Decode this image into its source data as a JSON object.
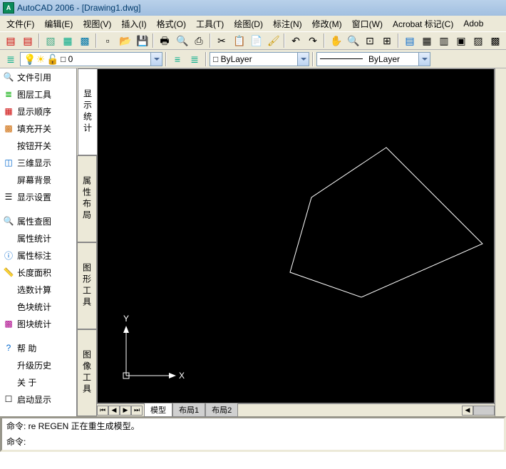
{
  "title": "AutoCAD 2006 - [Drawing1.dwg]",
  "menu": {
    "file": "文件(F)",
    "edit": "编辑(E)",
    "view": "视图(V)",
    "insert": "插入(I)",
    "format": "格式(O)",
    "tools": "工具(T)",
    "draw": "绘图(D)",
    "dim": "标注(N)",
    "modify": "修改(M)",
    "window": "窗口(W)",
    "acrobat": "Acrobat 标记(C)",
    "adobe": "Adob"
  },
  "layer_combo": "□ 0",
  "prop_combo1": "□ ByLayer",
  "prop_combo2": " ByLayer",
  "side": {
    "i1": "文件引用",
    "i2": "图层工具",
    "i3": "显示顺序",
    "i4": "填充开关",
    "i5": "按钮开关",
    "i6": "三维显示",
    "i7": "屏幕背景",
    "i8": "显示设置",
    "i9": "属性查图",
    "i10": "属性统计",
    "i11": "属性标注",
    "i12": "长度面积",
    "i13": "选数计算",
    "i14": "色块统计",
    "i15": "图块统计",
    "i16": "帮    助",
    "i17": "升级历史",
    "i18": "关    于",
    "i19": "启动显示"
  },
  "vtabs": {
    "t1": "显示统计",
    "t2": "属性布局",
    "t3": "图形工具",
    "t4": "图像工具"
  },
  "ptabs": {
    "model": "模型",
    "l1": "布局1",
    "l2": "布局2"
  },
  "axis": {
    "x": "X",
    "y": "Y"
  },
  "cmd": {
    "line1": "命令: re REGEN 正在重生成模型。",
    "line2": "命令:"
  }
}
